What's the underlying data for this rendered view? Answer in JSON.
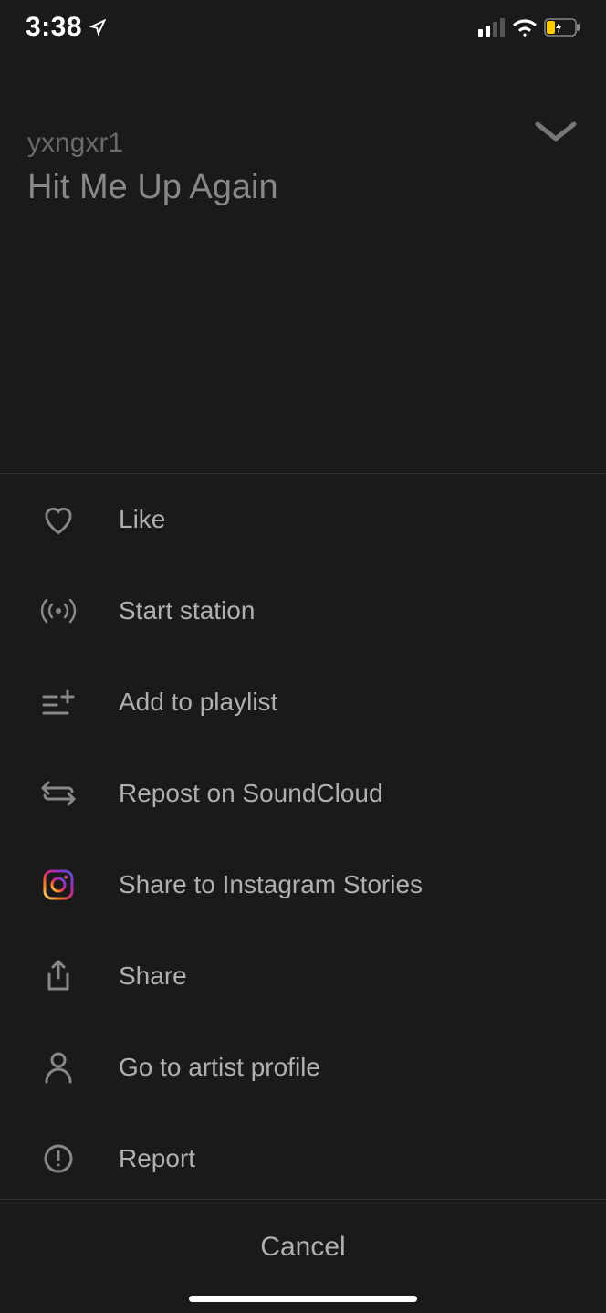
{
  "status_bar": {
    "time": "3:38"
  },
  "header": {
    "artist": "yxngxr1",
    "track": "Hit Me Up Again"
  },
  "menu": {
    "items": [
      {
        "icon": "heart-icon",
        "label": "Like"
      },
      {
        "icon": "station-icon",
        "label": "Start station"
      },
      {
        "icon": "playlist-add-icon",
        "label": "Add to playlist"
      },
      {
        "icon": "repost-icon",
        "label": "Repost on SoundCloud"
      },
      {
        "icon": "instagram-icon",
        "label": "Share to Instagram Stories"
      },
      {
        "icon": "share-icon",
        "label": "Share"
      },
      {
        "icon": "profile-icon",
        "label": "Go to artist profile"
      },
      {
        "icon": "report-icon",
        "label": "Report"
      }
    ]
  },
  "footer": {
    "cancel_label": "Cancel"
  }
}
